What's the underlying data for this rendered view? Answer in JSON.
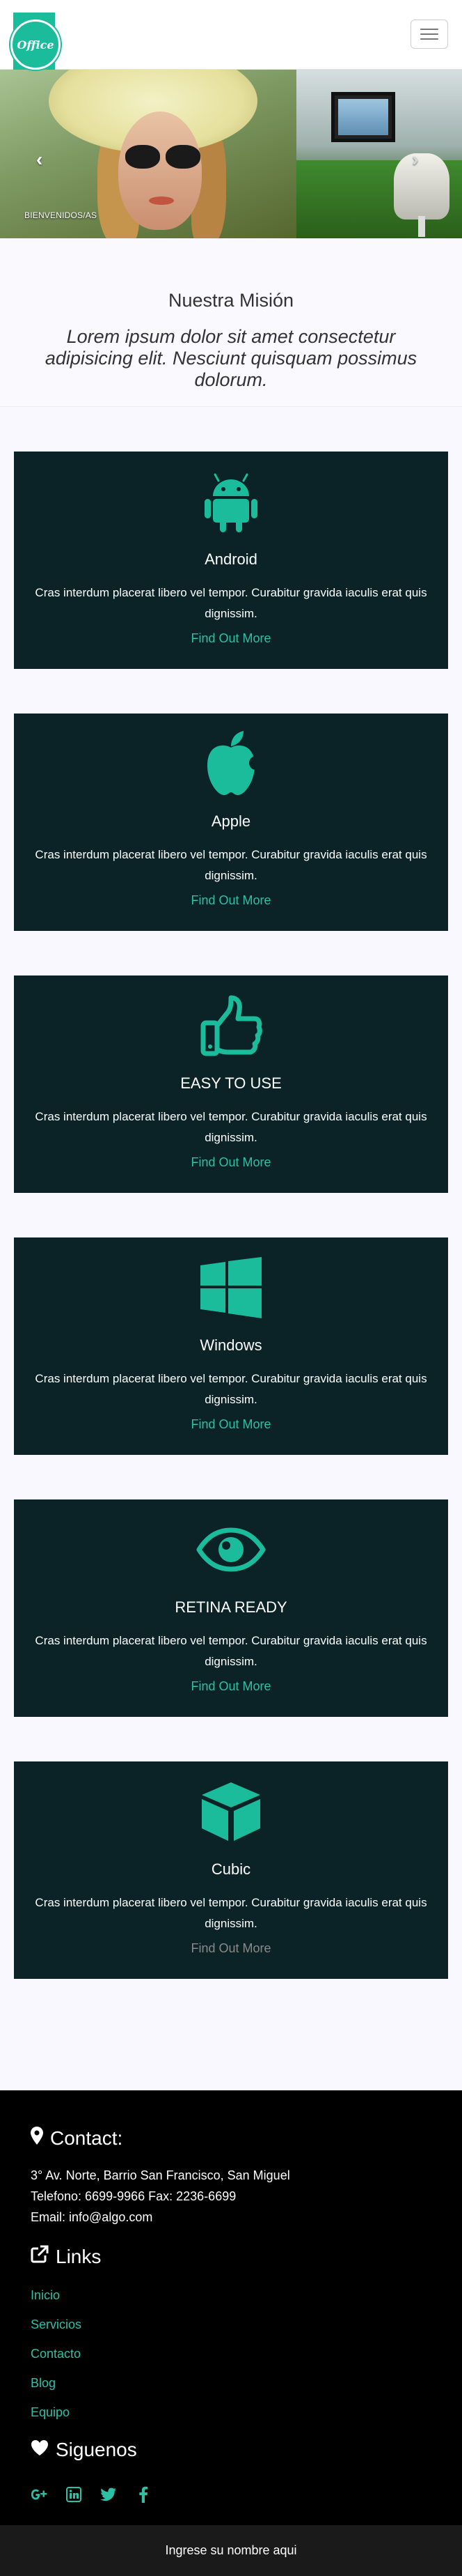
{
  "navbar": {
    "logo_text": "Office",
    "toggle_label": "Toggle navigation"
  },
  "carousel": {
    "caption": "BIENVENIDOS/AS",
    "prev": "‹",
    "next": "›"
  },
  "mission": {
    "title": "Nuestra Misión",
    "text": "Lorem ipsum dolor sit amet consectetur adipisicing elit. Nesciunt quisquam possimus dolorum."
  },
  "cards": [
    {
      "icon": "android-icon",
      "title": "Android",
      "text": "Cras interdum placerat libero vel tempor. Curabitur gravida iaculis erat quis dignissim.",
      "link": "Find Out More"
    },
    {
      "icon": "apple-icon",
      "title": "Apple",
      "text": "Cras interdum placerat libero vel tempor. Curabitur gravida iaculis erat quis dignissim.",
      "link": "Find Out More"
    },
    {
      "icon": "thumbs-up-icon",
      "title": "EASY TO USE",
      "text": "Cras interdum placerat libero vel tempor. Curabitur gravida iaculis erat quis dignissim.",
      "link": "Find Out More"
    },
    {
      "icon": "windows-icon",
      "title": "Windows",
      "text": "Cras interdum placerat libero vel tempor. Curabitur gravida iaculis erat quis dignissim.",
      "link": "Find Out More"
    },
    {
      "icon": "eye-icon",
      "title": "RETINA READY",
      "text": "Cras interdum placerat libero vel tempor. Curabitur gravida iaculis erat quis dignissim.",
      "link": "Find Out More"
    },
    {
      "icon": "cube-icon",
      "title": "Cubic",
      "text": "Cras interdum placerat libero vel tempor. Curabitur gravida iaculis erat quis dignissim.",
      "link": "Find Out More"
    }
  ],
  "footer": {
    "contact_heading": "Contact:",
    "address": "3° Av. Norte, Barrio San Francisco, San Miguel",
    "phone": "Telefono: 6699-9966 Fax: 2236-6699",
    "email": "Email: info@algo.com",
    "links_heading": "Links",
    "links": [
      "Inicio",
      "Servicios",
      "Contacto",
      "Blog",
      "Equipo"
    ],
    "follow_heading": "Siguenos",
    "socials": [
      "google-plus-icon",
      "linkedin-icon",
      "twitter-icon",
      "facebook-icon"
    ]
  },
  "bottom": {
    "placeholder": "Ingrese su nombre aqui"
  },
  "colors": {
    "accent": "#1abc9c",
    "card_bg": "#0b2326",
    "link": "#2ec0a5",
    "footer_bg": "#000000"
  }
}
